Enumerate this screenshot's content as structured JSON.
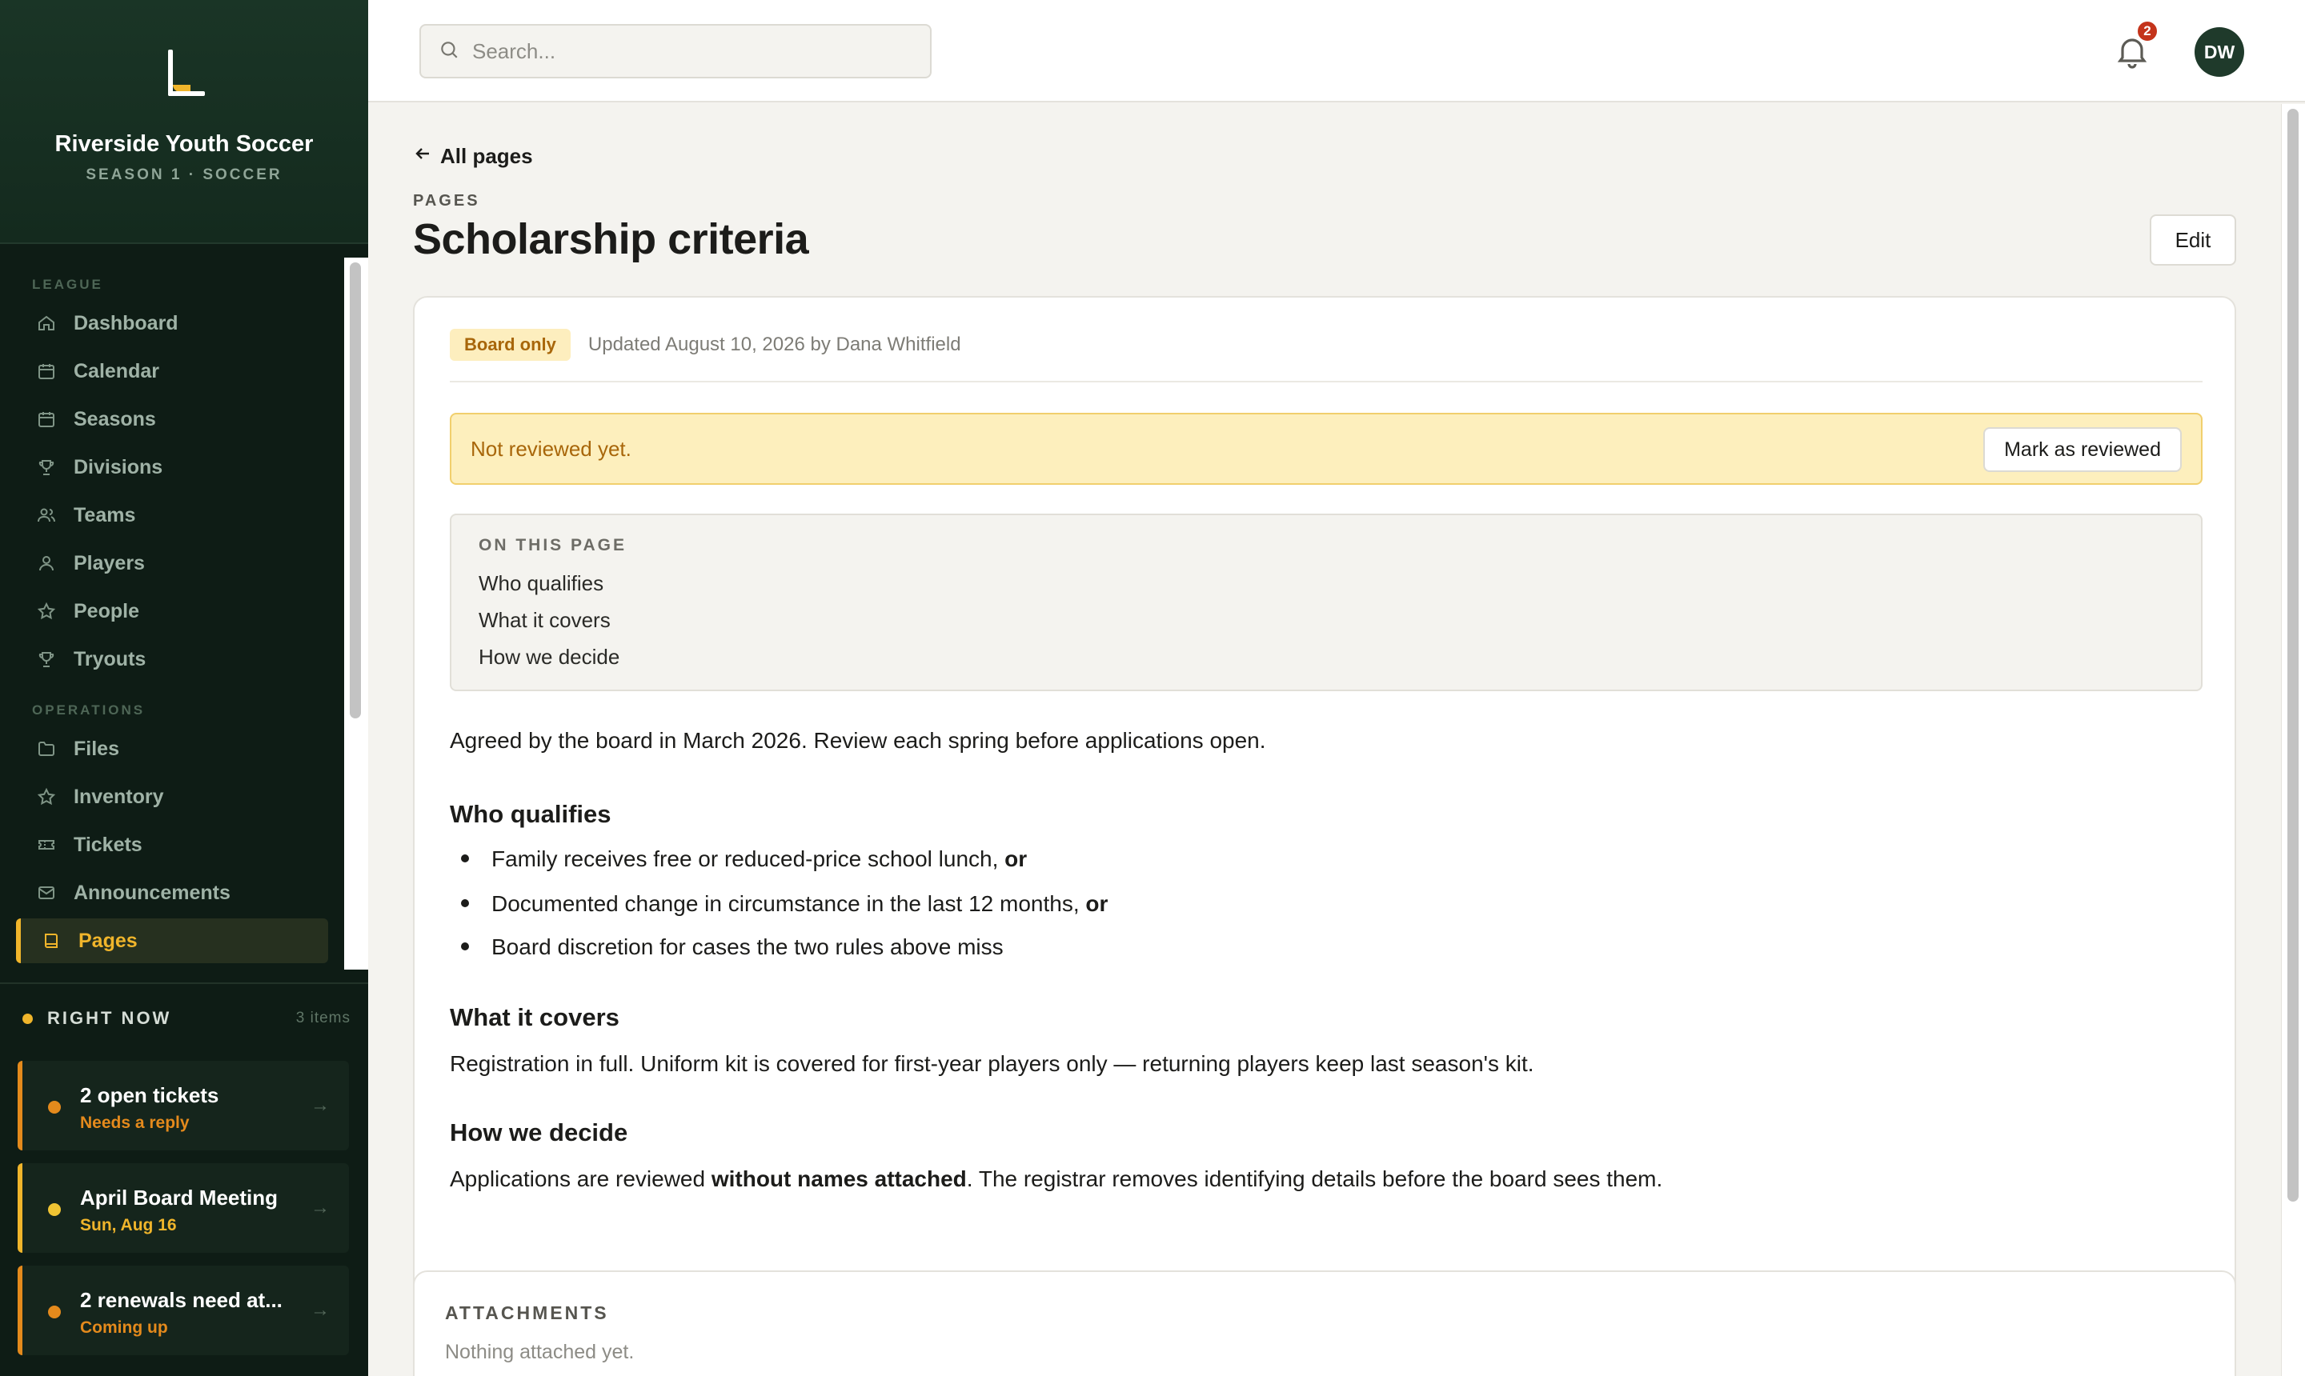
{
  "brand": {
    "name": "Riverside Youth Soccer",
    "subtitle": "SEASON 1 · SOCCER"
  },
  "nav": {
    "sections": [
      {
        "label": "LEAGUE",
        "items": [
          {
            "label": "Dashboard",
            "icon": "home-icon"
          },
          {
            "label": "Calendar",
            "icon": "calendar-icon"
          },
          {
            "label": "Seasons",
            "icon": "calendar-icon"
          },
          {
            "label": "Divisions",
            "icon": "trophy-icon"
          },
          {
            "label": "Teams",
            "icon": "users-icon"
          },
          {
            "label": "Players",
            "icon": "user-icon"
          },
          {
            "label": "People",
            "icon": "star-icon"
          },
          {
            "label": "Tryouts",
            "icon": "trophy-icon"
          }
        ]
      },
      {
        "label": "OPERATIONS",
        "items": [
          {
            "label": "Files",
            "icon": "folder-icon"
          },
          {
            "label": "Inventory",
            "icon": "star-icon"
          },
          {
            "label": "Tickets",
            "icon": "ticket-icon"
          },
          {
            "label": "Announcements",
            "icon": "mail-icon"
          },
          {
            "label": "Pages",
            "icon": "book-icon",
            "active": true
          }
        ]
      }
    ]
  },
  "right_now": {
    "title": "RIGHT NOW",
    "count": "3 items",
    "cards": [
      {
        "title": "2 open tickets",
        "subtitle": "Needs a reply",
        "tone": "orange"
      },
      {
        "title": "April Board Meeting",
        "subtitle": "Sun, Aug 16",
        "tone": "yellow"
      },
      {
        "title": "2 renewals need at...",
        "subtitle": "Coming up",
        "tone": "orange"
      }
    ]
  },
  "topbar": {
    "search_placeholder": "Search...",
    "notification_count": "2",
    "avatar_initials": "DW"
  },
  "page": {
    "back_label": "All pages",
    "eyebrow": "PAGES",
    "title": "Scholarship criteria",
    "edit_label": "Edit",
    "visibility_badge": "Board only",
    "updated_text": "Updated August 10, 2026 by Dana Whitfield",
    "notice": {
      "text": "Not reviewed yet.",
      "button": "Mark as reviewed"
    },
    "toc": {
      "label": "ON THIS PAGE",
      "items": [
        "Who qualifies",
        "What it covers",
        "How we decide"
      ]
    },
    "intro": "Agreed by the board in March 2026. Review each spring before applications open.",
    "sections": {
      "qualifies": {
        "heading": "Who qualifies",
        "bullets": [
          {
            "text": "Family receives free or reduced-price school lunch,",
            "emphasis": "or"
          },
          {
            "text": "Documented change in circumstance in the last 12 months,",
            "emphasis": "or"
          },
          {
            "text": "Board discretion for cases the two rules above miss",
            "emphasis": ""
          }
        ]
      },
      "covers": {
        "heading": "What it covers",
        "body": "Registration in full. Uniform kit is covered for first-year players only — returning players keep last season's kit."
      },
      "decide": {
        "heading": "How we decide",
        "body_before": "Applications are reviewed ",
        "body_bold": "without names attached",
        "body_after": ". The registrar removes identifying details before the board sees them."
      }
    },
    "attachments": {
      "title": "ATTACHMENTS",
      "empty": "Nothing attached yet."
    }
  },
  "colors": {
    "accent": "#f0b52b",
    "alert": "#e48a1c",
    "sidebar": "#0e1c15",
    "badge": "#c4341b"
  }
}
